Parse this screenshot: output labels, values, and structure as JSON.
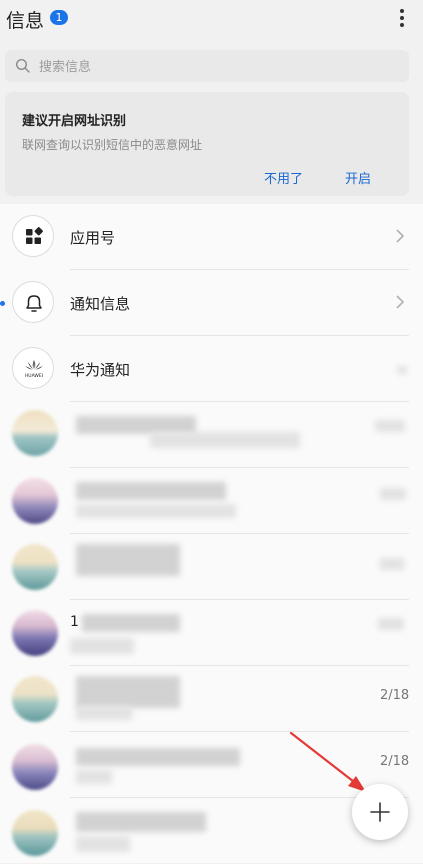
{
  "header": {
    "title": "信息",
    "badge": "1",
    "more_icon": "more-vertical-icon"
  },
  "search": {
    "placeholder": "搜索信息",
    "icon": "search-icon"
  },
  "banner": {
    "title": "建议开启网址识别",
    "description": "联网查询以识别短信中的恶意网址",
    "dismiss_label": "不用了",
    "enable_label": "开启"
  },
  "rows": [
    {
      "label": "应用号",
      "icon": "grid-apps-icon"
    },
    {
      "label": "通知信息",
      "icon": "bell-icon",
      "unread": true
    },
    {
      "label": "华为通知",
      "icon": "huawei-logo-icon",
      "logo_text": "HUAWEI"
    }
  ],
  "conversations": [
    {
      "date": ""
    },
    {
      "date": ""
    },
    {
      "date": ""
    },
    {
      "name_prefix": "1",
      "date": ""
    },
    {
      "date": "2/18"
    },
    {
      "date": "2/18"
    },
    {
      "date": ""
    }
  ],
  "fab": {
    "icon": "plus-icon"
  },
  "colors": {
    "accent": "#1a73e8",
    "link": "#1a67d2",
    "annotation_arrow": "#e53935"
  }
}
